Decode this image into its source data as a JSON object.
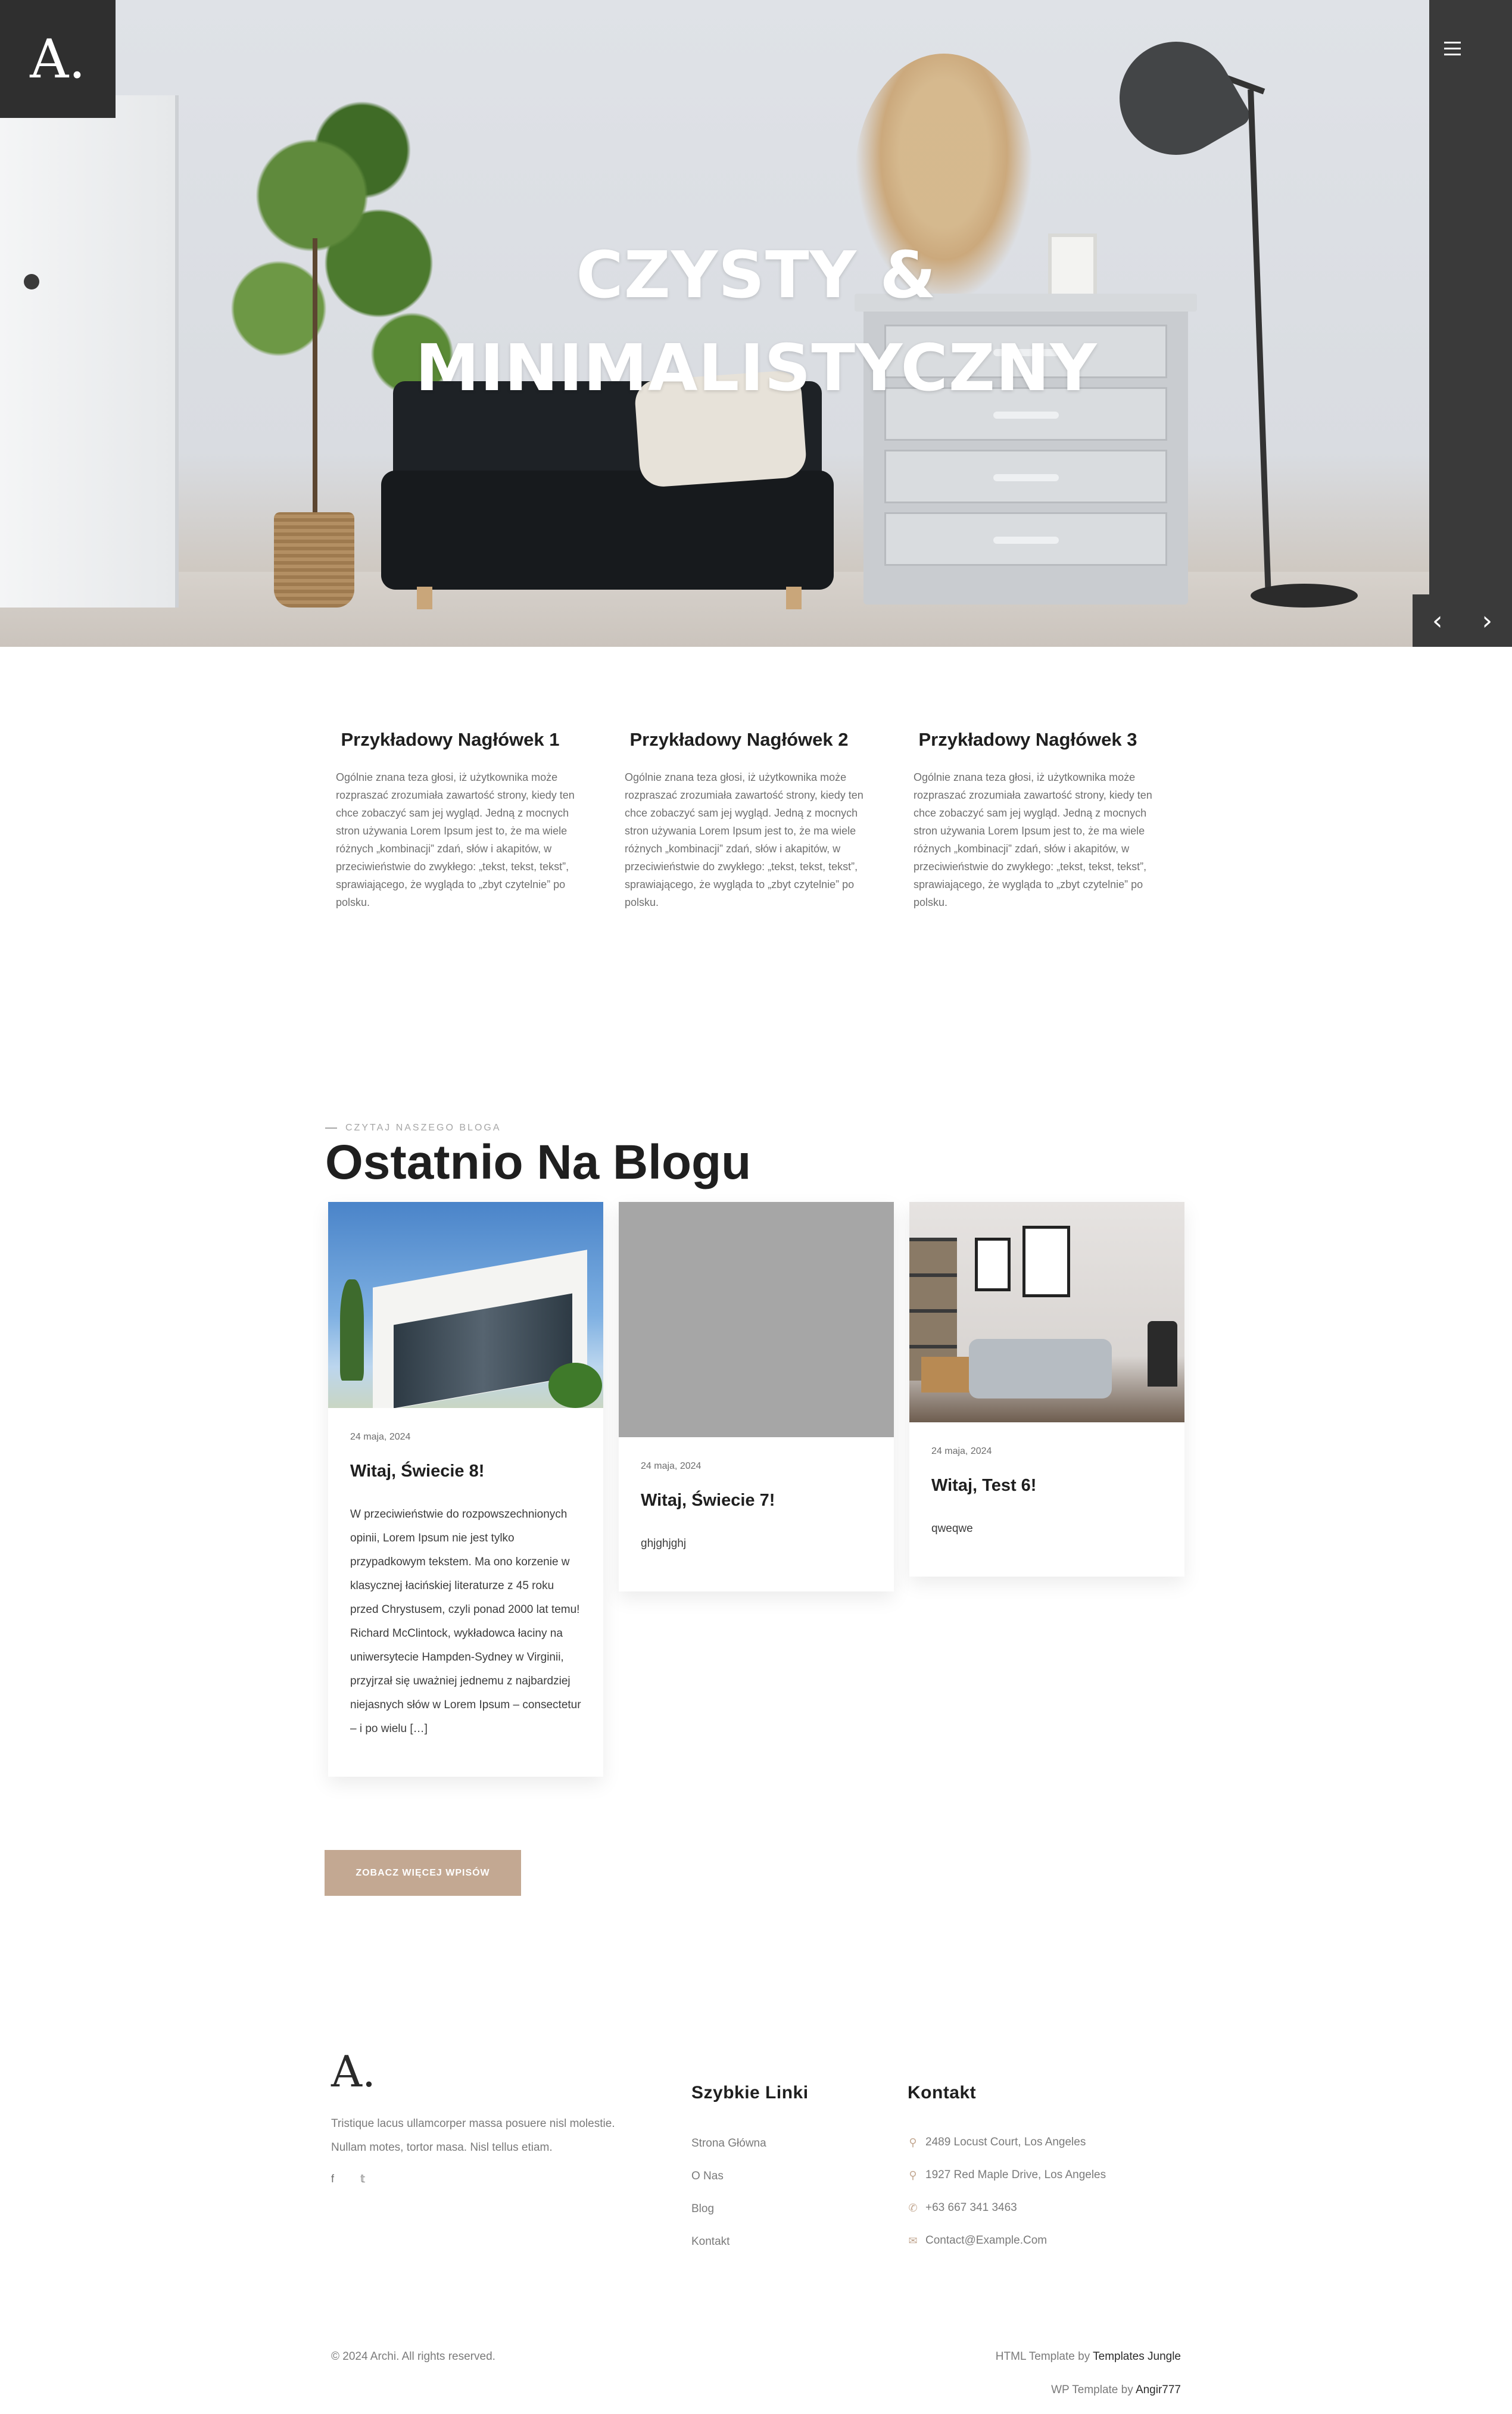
{
  "brand": {
    "logo": "A."
  },
  "hero": {
    "title_line1": "CZYSTY &",
    "title_line2": "MINIMALISTYCZNY",
    "prev_icon": "chevron-left-icon",
    "next_icon": "chevron-right-icon",
    "menu_icon": "hamburger-menu-icon"
  },
  "features": [
    {
      "heading": "Przykładowy Nagłówek 1",
      "text": "Ogólnie znana teza głosi, iż użytkownika może rozpraszać zrozumiała zawartość strony, kiedy ten chce zobaczyć sam jej wygląd. Jedną z mocnych stron używania Lorem Ipsum jest to, że ma wiele różnych „kombinacji” zdań, słów i akapitów, w przeciwieństwie do zwykłego: „tekst, tekst, tekst”, sprawiającego, że wygląda to „zbyt czytelnie” po polsku."
    },
    {
      "heading": "Przykładowy Nagłówek 2",
      "text": "Ogólnie znana teza głosi, iż użytkownika może rozpraszać zrozumiała zawartość strony, kiedy ten chce zobaczyć sam jej wygląd. Jedną z mocnych stron używania Lorem Ipsum jest to, że ma wiele różnych „kombinacji” zdań, słów i akapitów, w przeciwieństwie do zwykłego: „tekst, tekst, tekst”, sprawiającego, że wygląda to „zbyt czytelnie” po polsku."
    },
    {
      "heading": "Przykładowy Nagłówek 3",
      "text": "Ogólnie znana teza głosi, iż użytkownika może rozpraszać zrozumiała zawartość strony, kiedy ten chce zobaczyć sam jej wygląd. Jedną z mocnych stron używania Lorem Ipsum jest to, że ma wiele różnych „kombinacji” zdań, słów i akapitów, w przeciwieństwie do zwykłego: „tekst, tekst, tekst”, sprawiającego, że wygląda to „zbyt czytelnie” po polsku."
    }
  ],
  "blog": {
    "kicker": "CZYTAJ NASZEGO BLOGA",
    "title": "Ostatnio Na Blogu",
    "posts": [
      {
        "date": "24 maja, 2024",
        "title": "Witaj, Świecie 8!",
        "excerpt": "W przeciwieństwie do rozpowszechnionych opinii, Lorem Ipsum nie jest tylko przypadkowym tekstem. Ma ono korzenie w klasycznej łacińskiej literaturze z 45 roku przed Chrystusem, czyli ponad 2000 lat temu! Richard McClintock, wykładowca łaciny na uniwersytecie Hampden-Sydney w Virginii, przyjrzał się uważniej jednemu z najbardziej niejasnych słów w Lorem Ipsum – consectetur – i po wielu […]"
      },
      {
        "date": "24 maja, 2024",
        "title": "Witaj, Świecie 7!",
        "excerpt": "ghjghjghj"
      },
      {
        "date": "24 maja, 2024",
        "title": "Witaj, Test 6!",
        "excerpt": "qweqwe"
      }
    ],
    "more_button": "ZOBACZ WIĘCEJ WPISÓW"
  },
  "footer": {
    "logo": "A.",
    "description": "Tristique lacus ullamcorper massa posuere nisl molestie. Nullam motes, tortor masa. Nisl tellus etiam.",
    "social": [
      {
        "icon": "facebook-icon",
        "glyph": "f"
      },
      {
        "icon": "twitter-icon",
        "glyph": "𝕥"
      }
    ],
    "quick_links_title": "Szybkie Linki",
    "quick_links": [
      "Strona Główna",
      "O Nas",
      "Blog",
      "Kontakt"
    ],
    "contact_title": "Kontakt",
    "contacts": [
      {
        "icon": "location-pin-icon",
        "glyph": "⚲",
        "text": "2489 Locust Court, Los Angeles"
      },
      {
        "icon": "location-pin-icon",
        "glyph": "⚲",
        "text": "1927 Red Maple Drive, Los Angeles"
      },
      {
        "icon": "phone-icon",
        "glyph": "✆",
        "text": "+63 667 341 3463"
      },
      {
        "icon": "mail-icon",
        "glyph": "✉",
        "text": "Contact@Example.Com"
      }
    ],
    "copyright": "© 2024 Archi. All rights reserved.",
    "credit1_prefix": "HTML Template by ",
    "credit1_link": "Templates Jungle",
    "credit2_prefix": "WP Template by ",
    "credit2_link": "Angir777"
  },
  "colors": {
    "accent": "#c3a892",
    "dark": "#2f2f2f",
    "text": "#1f1f1f",
    "muted": "#7a7a7a"
  }
}
